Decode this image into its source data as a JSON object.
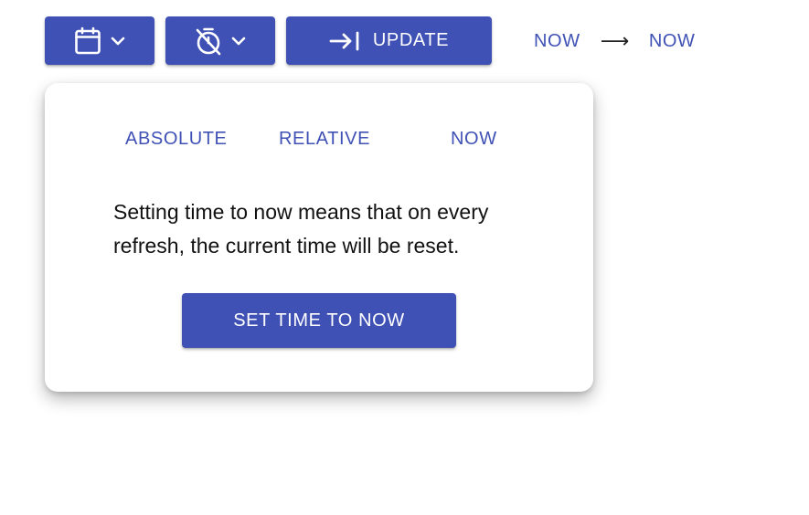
{
  "toolbar": {
    "calendar_icon": "calendar-icon",
    "timer_off_icon": "timer-off-icon",
    "chevron_icon": "chevron-down-icon",
    "update_icon": "arrow-right-to-bar-icon",
    "update_label": "UPDATE"
  },
  "range": {
    "start": "NOW",
    "arrow": "⟶",
    "end": "NOW"
  },
  "popover": {
    "tabs": [
      {
        "label": "ABSOLUTE"
      },
      {
        "label": "RELATIVE"
      },
      {
        "label": "NOW"
      }
    ],
    "description": "Setting time to now means that on every refresh, the current time will be reset.",
    "action_label": "SET TIME TO NOW"
  },
  "colors": {
    "primary": "#3f51b5",
    "text": "#111111",
    "background": "#ffffff"
  }
}
